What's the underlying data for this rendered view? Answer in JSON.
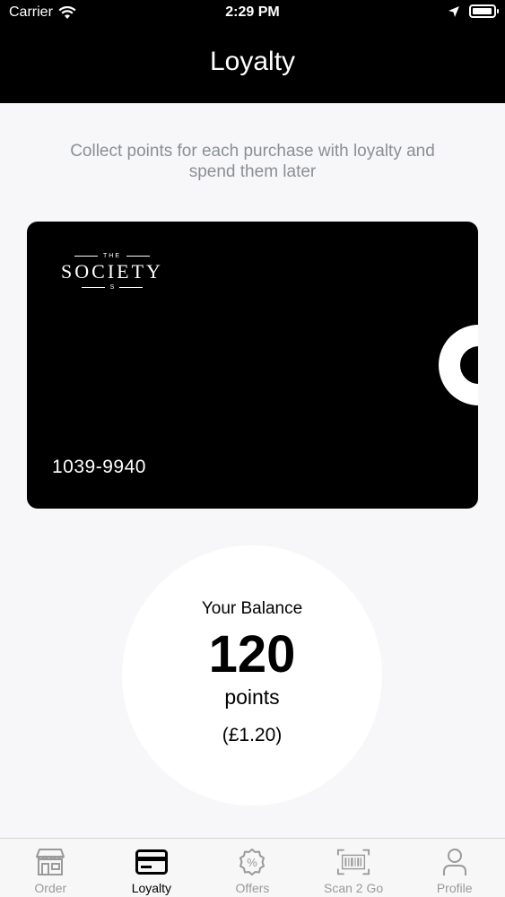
{
  "status_bar": {
    "carrier": "Carrier",
    "time": "2:29 PM"
  },
  "nav": {
    "title": "Loyalty"
  },
  "subtitle": "Collect points for each purchase with loyalty and spend them later",
  "card": {
    "logo": {
      "the": "THE",
      "name": "SOCIETY",
      "mark": "S"
    },
    "number": "1039-9940"
  },
  "balance": {
    "label": "Your Balance",
    "value": "120",
    "unit": "points",
    "money": "(£1.20)"
  },
  "tabs": [
    {
      "label": "Order",
      "icon": "store-icon",
      "active": false
    },
    {
      "label": "Loyalty",
      "icon": "card-icon",
      "active": true
    },
    {
      "label": "Offers",
      "icon": "discount-badge-icon",
      "active": false
    },
    {
      "label": "Scan 2 Go",
      "icon": "barcode-icon",
      "active": false
    },
    {
      "label": "Profile",
      "icon": "person-icon",
      "active": false
    }
  ],
  "colors": {
    "header": "#000000",
    "background": "#f7f7f9",
    "subtitle": "#8a8f95",
    "tab_inactive": "#9a9a9a",
    "tab_active": "#000000"
  }
}
